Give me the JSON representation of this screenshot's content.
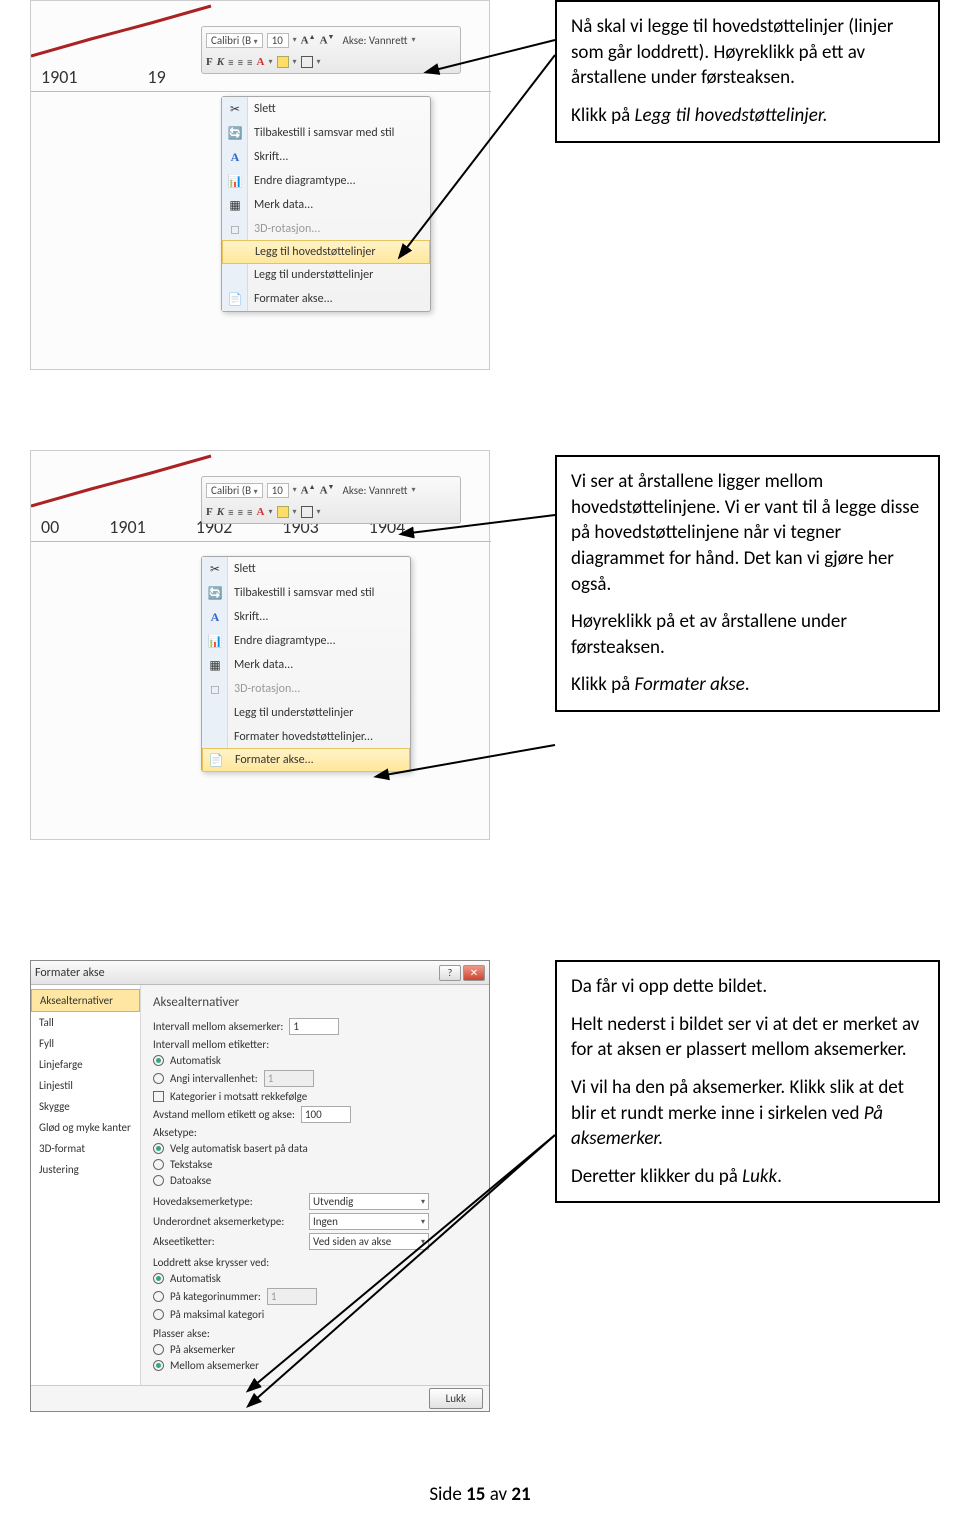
{
  "callouts": {
    "c1": {
      "p1": "Nå skal vi legge til hovedstøttelinjer (linjer som går loddrett). Høyreklikk på ett av årstallene under førsteaksen.",
      "p2_pre": "Klikk på ",
      "p2_em": "Legg til hovedstøttelinjer."
    },
    "c2": {
      "p1": "Vi ser at årstallene ligger mellom hovedstøttelinjene. Vi er vant til å legge disse på hovedstøttelinjene når vi tegner diagrammet for hånd. Det kan vi gjøre her også.",
      "p2": "Høyreklikk på et av årstallene under førsteaksen.",
      "p3_pre": "Klikk på ",
      "p3_em": "Formater akse",
      "p3_post": "."
    },
    "c3": {
      "p1": "Da får vi opp dette bildet.",
      "p2": "Helt nederst i bildet ser vi at det er merket av for at aksen er plassert mellom aksemerker.",
      "p3_pre": "Vi vil ha den på aksemerker. Klikk slik at det blir et rundt merke inne i sirkelen ved ",
      "p3_em": "På aksemerker.",
      "p4_pre": "Deretter klikker du på ",
      "p4_em": "Lukk",
      "p4_post": "."
    }
  },
  "toolbar": {
    "font": "Calibri (B",
    "size": "10",
    "axis_label": "Akse: Vannrett"
  },
  "axis_years": {
    "y0": "00",
    "y1": "1901",
    "y2": "1902",
    "y3": "1903",
    "y4": "1904"
  },
  "axis_years_s1": {
    "y1": "1901",
    "y2": "19"
  },
  "menu1": {
    "delete": "Slett",
    "reset": "Tilbakestill i samsvar med stil",
    "font": "Skrift...",
    "chart": "Endre diagramtype...",
    "data": "Merk data...",
    "rot": "3D-rotasjon...",
    "major": "Legg til hovedstøttelinjer",
    "minor": "Legg til understøttelinjer",
    "format": "Formater akse..."
  },
  "menu2": {
    "delete": "Slett",
    "reset": "Tilbakestill i samsvar med stil",
    "font": "Skrift...",
    "chart": "Endre diagramtype...",
    "data": "Merk data...",
    "rot": "3D-rotasjon...",
    "minor": "Legg til understøttelinjer",
    "fmtmajor": "Formater hovedstøttelinjer...",
    "format": "Formater akse..."
  },
  "dialog": {
    "title": "Formater akse",
    "sidebar": {
      "aksealternativer": "Aksealternativer",
      "tall": "Tall",
      "fyll": "Fyll",
      "linjefarge": "Linjefarge",
      "linjestil": "Linjestil",
      "skygge": "Skygge",
      "glod": "Glød og myke kanter",
      "format3d": "3D-format",
      "justering": "Justering"
    },
    "panel": {
      "heading": "Aksealternativer",
      "interval_ticks": "Intervall mellom aksemerker:",
      "interval_ticks_val": "1",
      "interval_labels": "Intervall mellom etiketter:",
      "automatic": "Automatisk",
      "specify_int": "Angi intervallenhet:",
      "specify_int_val": "1",
      "reverse": "Kategorier i motsatt rekkefølge",
      "label_dist": "Avstand mellom etikett og akse:",
      "label_dist_val": "100",
      "axis_type_h": "Aksetype:",
      "axis_auto": "Velg automatisk basert på data",
      "axis_text": "Tekstakse",
      "axis_date": "Datoakse",
      "major_tick": "Hovedaksemerketyp e:",
      "major_tick_label": "Hovedaksemerketype:",
      "major_tick_val": "Utvendig",
      "minor_tick_label": "Underordnet aksemerketype:",
      "minor_tick_val": "Ingen",
      "tick_labels": "Akseetiketter:",
      "tick_labels_val": "Ved siden av akse",
      "cross_h": "Loddrett akse krysser ved:",
      "cross_auto": "Automatisk",
      "cross_cat": "På kategorinummer:",
      "cross_cat_val": "1",
      "cross_max": "På maksimal kategori",
      "position_h": "Plasser akse:",
      "pos_on": "På aksemerker",
      "pos_between": "Mellom aksemerker",
      "close": "Lukk"
    }
  },
  "page": {
    "label_pre": "Side ",
    "num": "15",
    "label_mid": " av ",
    "total": "21"
  }
}
